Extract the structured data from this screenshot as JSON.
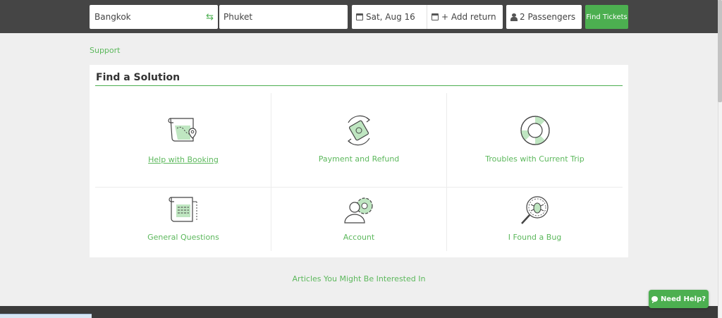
{
  "search": {
    "from": "Bangkok",
    "to": "Phuket",
    "date": "Sat, Aug 16",
    "return_label": "+ Add return",
    "passengers": "2 Passengers",
    "find_label": "Find Tickets"
  },
  "breadcrumb": {
    "support": "Support"
  },
  "solutions": {
    "title": "Find a Solution",
    "items": [
      {
        "label": "Help with Booking",
        "icon": "map-pin-scroll-icon"
      },
      {
        "label": "Payment and Refund",
        "icon": "money-cycle-icon"
      },
      {
        "label": "Troubles with Current Trip",
        "icon": "lifebuoy-icon"
      },
      {
        "label": "General Questions",
        "icon": "document-scroll-icon"
      },
      {
        "label": "Account",
        "icon": "user-gear-icon"
      },
      {
        "label": "I Found a Bug",
        "icon": "bug-magnifier-icon"
      }
    ]
  },
  "articles": {
    "label": "Articles You Might Be Interested In"
  },
  "help_widget": {
    "label": "Need Help?"
  },
  "colors": {
    "accent": "#4caf50",
    "topbar": "#454545",
    "link": "#5cb85c"
  }
}
